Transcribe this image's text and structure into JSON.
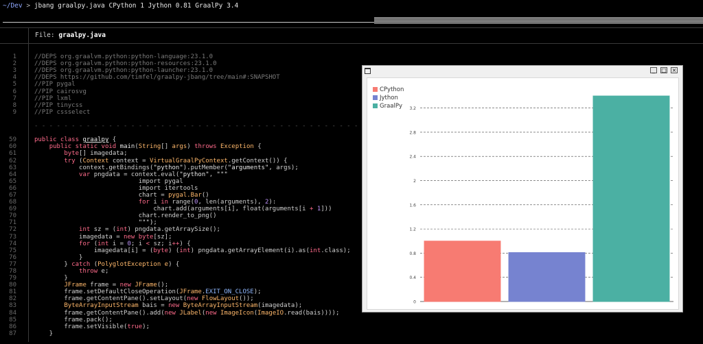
{
  "terminal": {
    "prompt_path": "~/Dev",
    "prompt_arrow": ">",
    "command": "jbang graalpy.java CPython 1 Jython 0.81 GraalPy 3.4"
  },
  "file_header": {
    "label": "File:",
    "filename": "graalpy.java"
  },
  "code_head": [
    {
      "ln": "1",
      "text": "//DEPS org.graalvm.python:python-language:23.1.0"
    },
    {
      "ln": "2",
      "text": "//DEPS org.graalvm.python:python-resources:23.1.0"
    },
    {
      "ln": "3",
      "text": "//DEPS org.graalvm.python:python-launcher:23.1.0"
    },
    {
      "ln": "4",
      "text": "//DEPS https://github.com/timfel/graalpy-jbang/tree/main#:SNAPSHOT"
    },
    {
      "ln": "5",
      "text": "//PIP pygal"
    },
    {
      "ln": "6",
      "text": "//PIP cairosvg"
    },
    {
      "ln": "7",
      "text": "//PIP lxml"
    },
    {
      "ln": "8",
      "text": "//PIP tinycss"
    },
    {
      "ln": "9",
      "text": "//PIP cssselect"
    }
  ],
  "fold_marker": "- - - - - - - - - - - - - - - - - - - - - - - - - - - - - - - - - - - - - - - - - - - - - - - - - - - - - - - - - - - - - - - - - - - - - - - - - - - - - - - - - - - - - - -",
  "code_body_lines": [
    "59",
    "60",
    "61",
    "62",
    "63",
    "64",
    "65",
    "66",
    "67",
    "68",
    "69",
    "70",
    "71",
    "72",
    "73",
    "74",
    "75",
    "76",
    "77",
    "78",
    "79",
    "80",
    "81",
    "82",
    "83",
    "84",
    "85",
    "86",
    "87"
  ],
  "chart_window": {
    "buttons": [
      "_",
      "□",
      "×"
    ]
  },
  "chart_data": {
    "type": "bar",
    "categories": [
      "CPython",
      "Jython",
      "GraalPy"
    ],
    "values": [
      1,
      0.81,
      3.4
    ],
    "colors": [
      "#f77b72",
      "#7683d0",
      "#4bb0a3"
    ],
    "legend": [
      "CPython",
      "Jython",
      "GraalPy"
    ],
    "legend_position": "top-left",
    "ylim": [
      0,
      3.4
    ],
    "yticks": [
      "0",
      "0.4",
      "0.8",
      "1.2",
      "1.6",
      "2",
      "2.4",
      "2.8",
      "3.2"
    ],
    "grid": "horizontal dashed"
  }
}
